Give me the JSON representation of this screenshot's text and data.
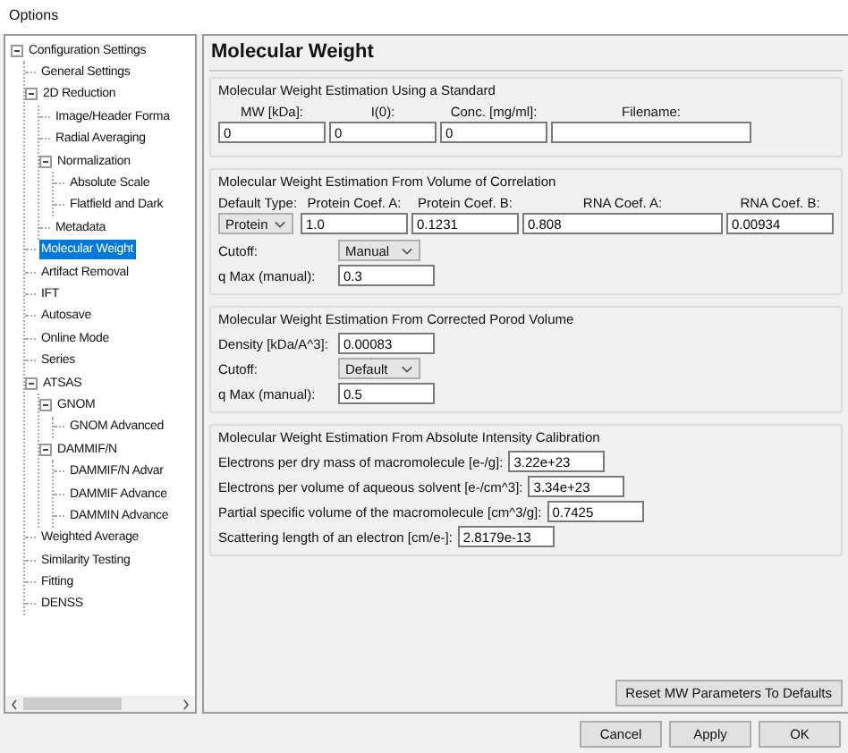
{
  "window": {
    "title": "Options"
  },
  "tree": [
    {
      "label": "Configuration Settings",
      "selected": false,
      "expanded": true,
      "children": [
        {
          "label": "General Settings",
          "selected": false
        },
        {
          "label": "2D Reduction",
          "selected": false,
          "expanded": true,
          "children": [
            {
              "label": "Image/Header Forma",
              "selected": false
            },
            {
              "label": "Radial Averaging",
              "selected": false
            },
            {
              "label": "Normalization",
              "selected": false,
              "expanded": true,
              "children": [
                {
                  "label": "Absolute Scale",
                  "selected": false
                },
                {
                  "label": "Flatfield and Dark",
                  "selected": false
                }
              ]
            },
            {
              "label": "Metadata",
              "selected": false
            }
          ]
        },
        {
          "label": "Molecular Weight",
          "selected": true
        },
        {
          "label": "Artifact Removal",
          "selected": false
        },
        {
          "label": "IFT",
          "selected": false
        },
        {
          "label": "Autosave",
          "selected": false
        },
        {
          "label": "Online Mode",
          "selected": false
        },
        {
          "label": "Series",
          "selected": false
        },
        {
          "label": "ATSAS",
          "selected": false,
          "expanded": true,
          "children": [
            {
              "label": "GNOM",
              "selected": false,
              "expanded": true,
              "children": [
                {
                  "label": "GNOM Advanced",
                  "selected": false
                }
              ]
            },
            {
              "label": "DAMMIF/N",
              "selected": false,
              "expanded": true,
              "children": [
                {
                  "label": "DAMMIF/N Advar",
                  "selected": false
                },
                {
                  "label": "DAMMIF Advance",
                  "selected": false
                },
                {
                  "label": "DAMMIN Advance",
                  "selected": false
                }
              ]
            }
          ]
        },
        {
          "label": "Weighted Average",
          "selected": false
        },
        {
          "label": "Similarity Testing",
          "selected": false
        },
        {
          "label": "Fitting",
          "selected": false
        },
        {
          "label": "DENSS",
          "selected": false
        }
      ]
    }
  ],
  "panel": {
    "title": "Molecular Weight",
    "standard": {
      "title": "Molecular Weight Estimation Using a Standard",
      "fields": [
        {
          "label": "MW [kDa]:",
          "value": "0"
        },
        {
          "label": "I(0):",
          "value": "0"
        },
        {
          "label": "Conc. [mg/ml]:",
          "value": "0"
        },
        {
          "label": "Filename:"
        }
      ]
    },
    "volume_of_correlation": {
      "title": "Molecular Weight Estimation From Volume of Correlation",
      "type_label": "Default Type:",
      "type_value": "Protein",
      "coefs": [
        {
          "label": "Protein Coef. A:",
          "value": "1.0"
        },
        {
          "label": "Protein Coef. B:",
          "value": "0.1231"
        },
        {
          "label": "RNA Coef. A:",
          "value": "0.808"
        },
        {
          "label": "RNA Coef. B:",
          "value": "0.00934"
        }
      ],
      "rows": [
        {
          "kind": "dropdown",
          "label": "Cutoff:",
          "value": "Manual"
        },
        {
          "kind": "input",
          "label": "q Max (manual):",
          "value": "0.3"
        }
      ]
    },
    "porod": {
      "title": "Molecular Weight Estimation From Corrected Porod Volume",
      "rows": [
        {
          "kind": "input",
          "label": "Density [kDa/A^3]:",
          "value": "0.00083"
        },
        {
          "kind": "dropdown",
          "label": "Cutoff:",
          "value": "Default"
        },
        {
          "kind": "input",
          "label": "q Max (manual):",
          "value": "0.5"
        }
      ]
    },
    "absolute": {
      "title": "Molecular Weight Estimation From Absolute Intensity Calibration",
      "rows": [
        {
          "kind": "input",
          "label": "Electrons per dry mass of macromolecule [e-/g]:",
          "value": "3.22e+23"
        },
        {
          "kind": "input",
          "label": "Electrons per volume of aqueous solvent [e-/cm^3]:",
          "value": "3.34e+23"
        },
        {
          "kind": "input",
          "label": "Partial specific volume of the macromolecule [cm^3/g]:",
          "value": "0.7425"
        },
        {
          "kind": "input",
          "label": "Scattering length of an electron [cm/e-]:",
          "value": "2.8179e-13"
        }
      ]
    },
    "reset_button": "Reset MW Parameters To Defaults"
  },
  "buttons": [
    "Cancel",
    "Apply",
    "OK"
  ]
}
